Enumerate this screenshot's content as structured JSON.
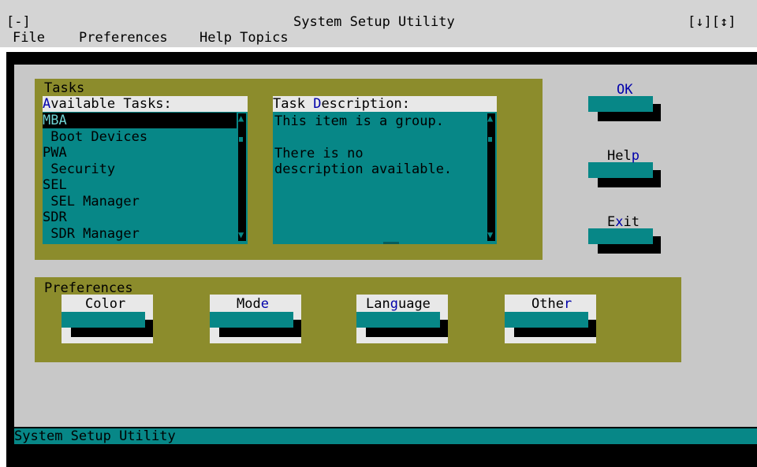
{
  "titlebar": {
    "control_menu": "[-]",
    "title": "System Setup Utility",
    "window_controls": "[↓][↕]"
  },
  "menu": {
    "items": [
      {
        "label": "File"
      },
      {
        "label": "Preferences"
      },
      {
        "label": "Help Topics"
      }
    ]
  },
  "tasks": {
    "group_label": "Tasks",
    "available_label_first": "A",
    "available_label_rest": "vailable Tasks:",
    "description_label_prefix": "Task ",
    "description_label_hot": "D",
    "description_label_rest": "escription:",
    "items": [
      {
        "label": "MBA",
        "indent": false,
        "selected": true
      },
      {
        "label": " Boot Devices",
        "indent": true,
        "selected": false
      },
      {
        "label": "PWA",
        "indent": false,
        "selected": false
      },
      {
        "label": " Security",
        "indent": true,
        "selected": false
      },
      {
        "label": "SEL",
        "indent": false,
        "selected": false
      },
      {
        "label": " SEL Manager",
        "indent": true,
        "selected": false
      },
      {
        "label": "SDR",
        "indent": false,
        "selected": false
      },
      {
        "label": " SDR Manager",
        "indent": true,
        "selected": false
      }
    ],
    "description_lines": [
      "This item is a group.",
      "",
      "There is no",
      "description available."
    ]
  },
  "buttons": {
    "ok": {
      "label": "OK",
      "hot": "O",
      "rest": "K"
    },
    "help": {
      "label": "Help",
      "prefix": "Hel",
      "hot": "p"
    },
    "exit": {
      "label": "Exit",
      "prefix": "E",
      "hot": "x",
      "rest": "it"
    }
  },
  "preferences": {
    "group_label": "Preferences",
    "color": {
      "label": "Color",
      "hot": "C",
      "rest": "olor"
    },
    "mode": {
      "label": "Mode",
      "prefix": "Mod",
      "hot": "e"
    },
    "language": {
      "label": "Language",
      "prefix": "Lan",
      "hot": "g",
      "rest": "uage"
    },
    "other": {
      "label": "Other",
      "prefix": "Othe",
      "hot": "r"
    }
  },
  "statusbar": {
    "text_hot": "S",
    "text_rest": "ystem Setup Utility"
  },
  "colors": {
    "teal": "#078787",
    "olive": "#8c8c2c",
    "desktop": "#c8c8c8",
    "hotkey": "#0000aa"
  }
}
